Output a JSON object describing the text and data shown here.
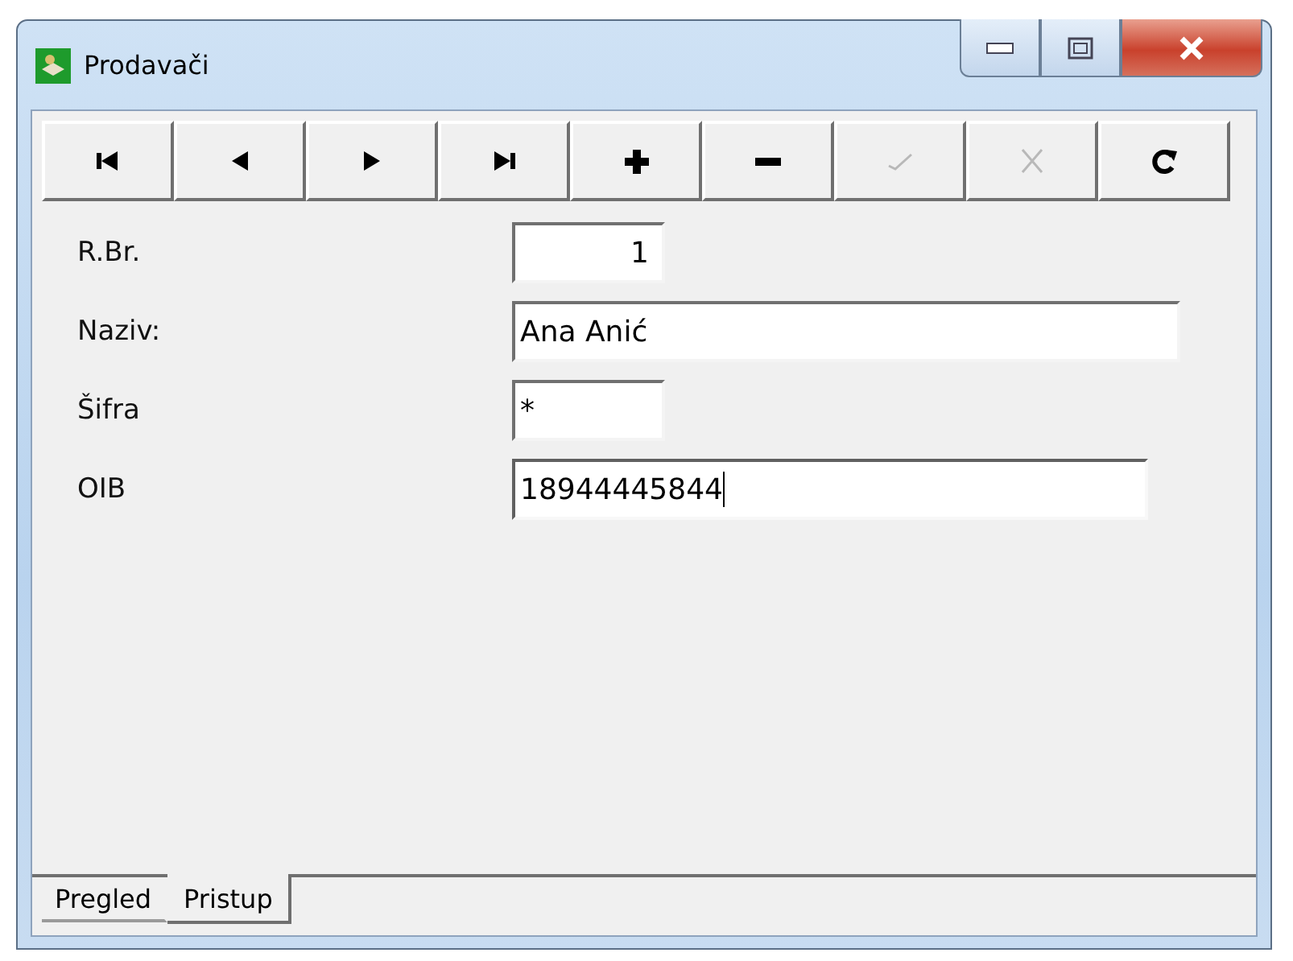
{
  "window": {
    "title": "Prodavači"
  },
  "toolbar": [
    {
      "kind": "first",
      "disabled": false
    },
    {
      "kind": "prev",
      "disabled": false
    },
    {
      "kind": "next",
      "disabled": false
    },
    {
      "kind": "last",
      "disabled": false
    },
    {
      "kind": "add",
      "disabled": false
    },
    {
      "kind": "remove",
      "disabled": false
    },
    {
      "kind": "post",
      "disabled": true
    },
    {
      "kind": "cancel",
      "disabled": true
    },
    {
      "kind": "refresh",
      "disabled": false
    }
  ],
  "fields": [
    {
      "label": "R.Br.",
      "value": "1",
      "focused": false
    },
    {
      "label": "Naziv:",
      "value": "Ana Anić",
      "focused": false
    },
    {
      "label": "Šifra",
      "value": "*",
      "focused": false
    },
    {
      "label": "OIB",
      "value": "18944445844",
      "focused": true
    }
  ],
  "tabs": [
    {
      "label": "Pregled",
      "selected": false
    },
    {
      "label": "Pristup",
      "selected": true
    }
  ]
}
